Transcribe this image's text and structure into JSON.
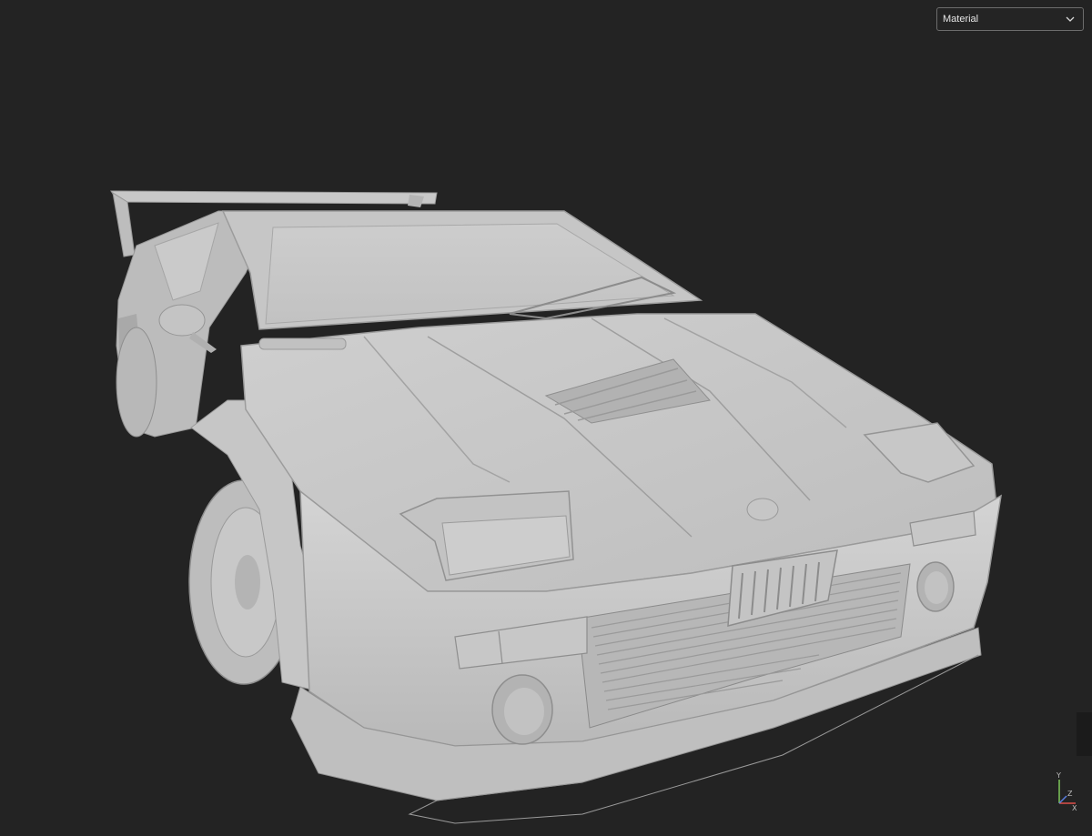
{
  "viewer": {
    "background_color": "#232323",
    "model_color": "#c9c9c9",
    "shading_mode": {
      "selected": "Material",
      "icon": "chevron-down-icon"
    },
    "axis_gizmo": {
      "labels": [
        "Y",
        "X",
        "Z"
      ],
      "colors": {
        "x": "#e0504a",
        "y": "#7ec85a",
        "z": "#5a7ee0"
      }
    }
  }
}
